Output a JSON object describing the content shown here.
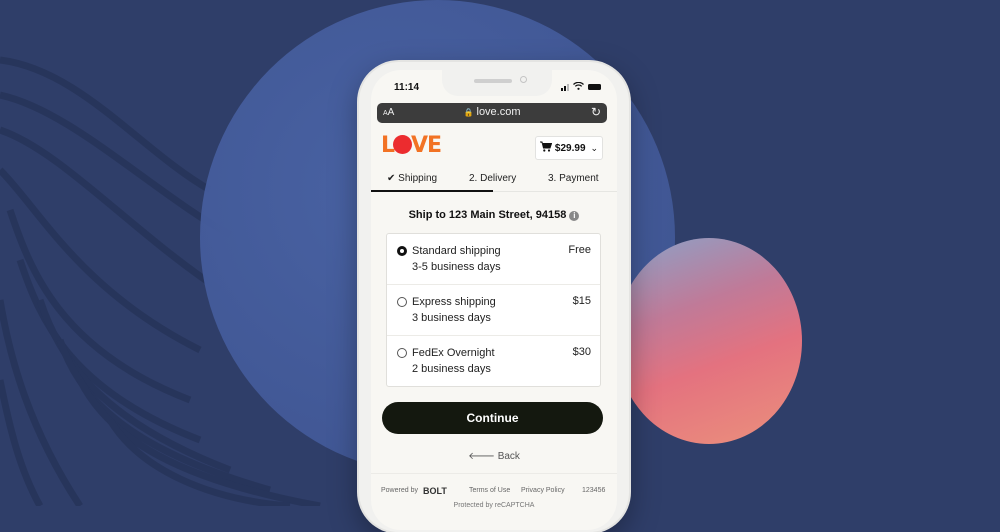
{
  "status_bar": {
    "time": "11:14"
  },
  "browser": {
    "text_size_label": "AA",
    "url": "love.com",
    "lock_icon": "lock-icon",
    "reload_icon": "reload-icon"
  },
  "header": {
    "logo_text": [
      "L",
      "VE"
    ],
    "cart_total": "$29.99",
    "cart_icon": "cart-icon"
  },
  "steps": [
    {
      "label": "✔ Shipping",
      "active": true
    },
    {
      "label": "2. Delivery",
      "active": false
    },
    {
      "label": "3. Payment",
      "active": false
    }
  ],
  "shipping": {
    "title": "Ship to 123 Main Street, 94158",
    "info_icon": "i",
    "options": [
      {
        "name": "Standard shipping",
        "days": "3-5 business days",
        "price": "Free",
        "selected": true
      },
      {
        "name": "Express shipping",
        "days": "3 business days",
        "price": "$15",
        "selected": false
      },
      {
        "name": "FedEx Overnight",
        "days": "2 business days",
        "price": "$30",
        "selected": false
      }
    ]
  },
  "actions": {
    "continue_label": "Continue",
    "back_label": "Back",
    "back_arrow": "🡐"
  },
  "footer": {
    "powered_by": "Powered by",
    "brand": "BOLT",
    "terms": "Terms of Use",
    "privacy": "Privacy Policy",
    "code": "123456",
    "captcha": "Protected by reCAPTCHA"
  }
}
